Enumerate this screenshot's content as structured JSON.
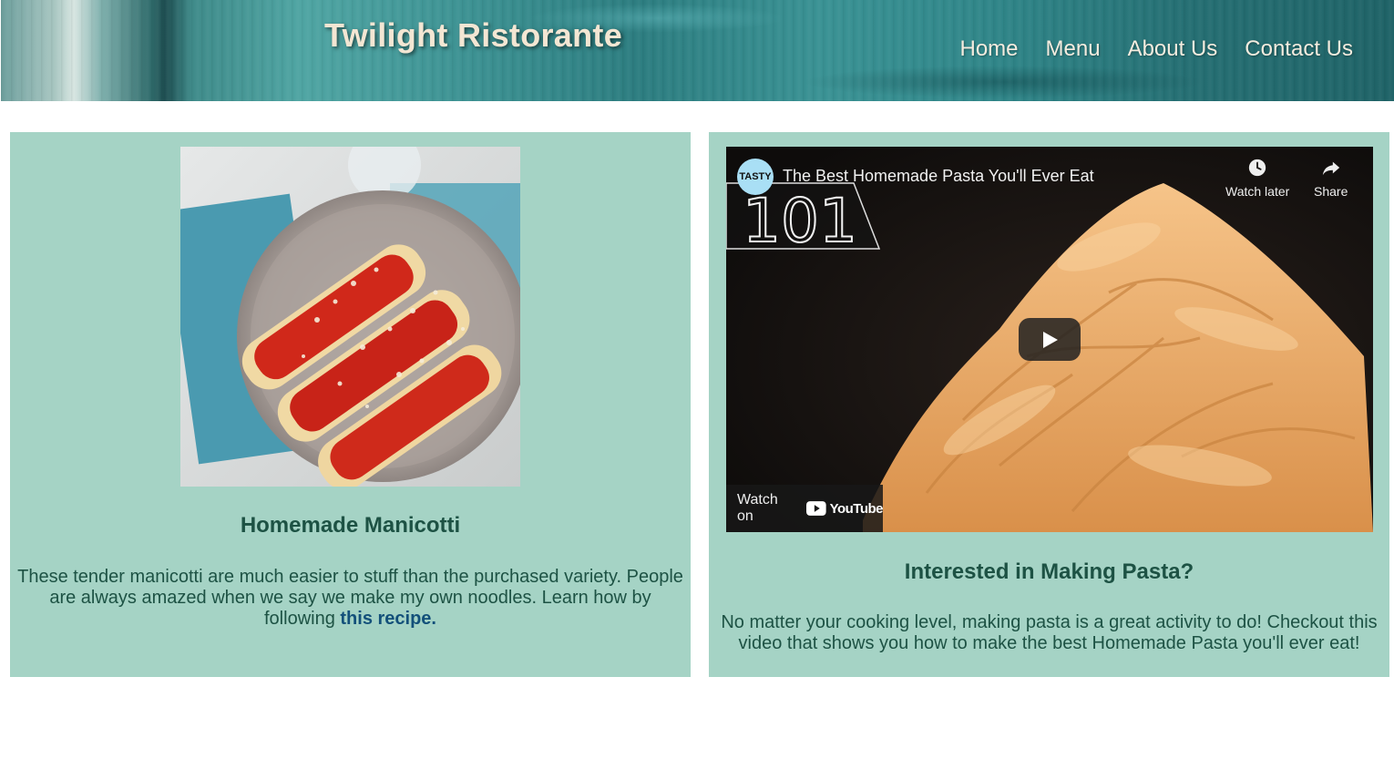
{
  "header": {
    "title": "Twilight Ristorante",
    "nav": [
      "Home",
      "Menu",
      "About Us",
      "Contact Us"
    ]
  },
  "left_card": {
    "heading": "Homemade Manicotti",
    "text_before_link": "These tender manicotti are much easier to stuff than the purchased variety. People are always amazed when we say we make my own noodles. Learn how by following ",
    "link_text": "this recipe."
  },
  "right_card": {
    "video": {
      "channel_logo": "TASTY",
      "title": "The Best Homemade Pasta You'll Ever Eat",
      "badge": "101",
      "watch_later": "Watch later",
      "share": "Share",
      "watch_on": "Watch on",
      "youtube": "YouTube"
    },
    "heading": "Interested in Making Pasta?",
    "text": "No matter your cooking level, making pasta is a great activity to do! Checkout this video that shows you how to make the best Homemade Pasta you'll ever eat!"
  },
  "colors": {
    "card_bg": "#a5d3c5",
    "text": "#1d5244",
    "link": "#13507a",
    "header_title": "#f3e6d3"
  }
}
